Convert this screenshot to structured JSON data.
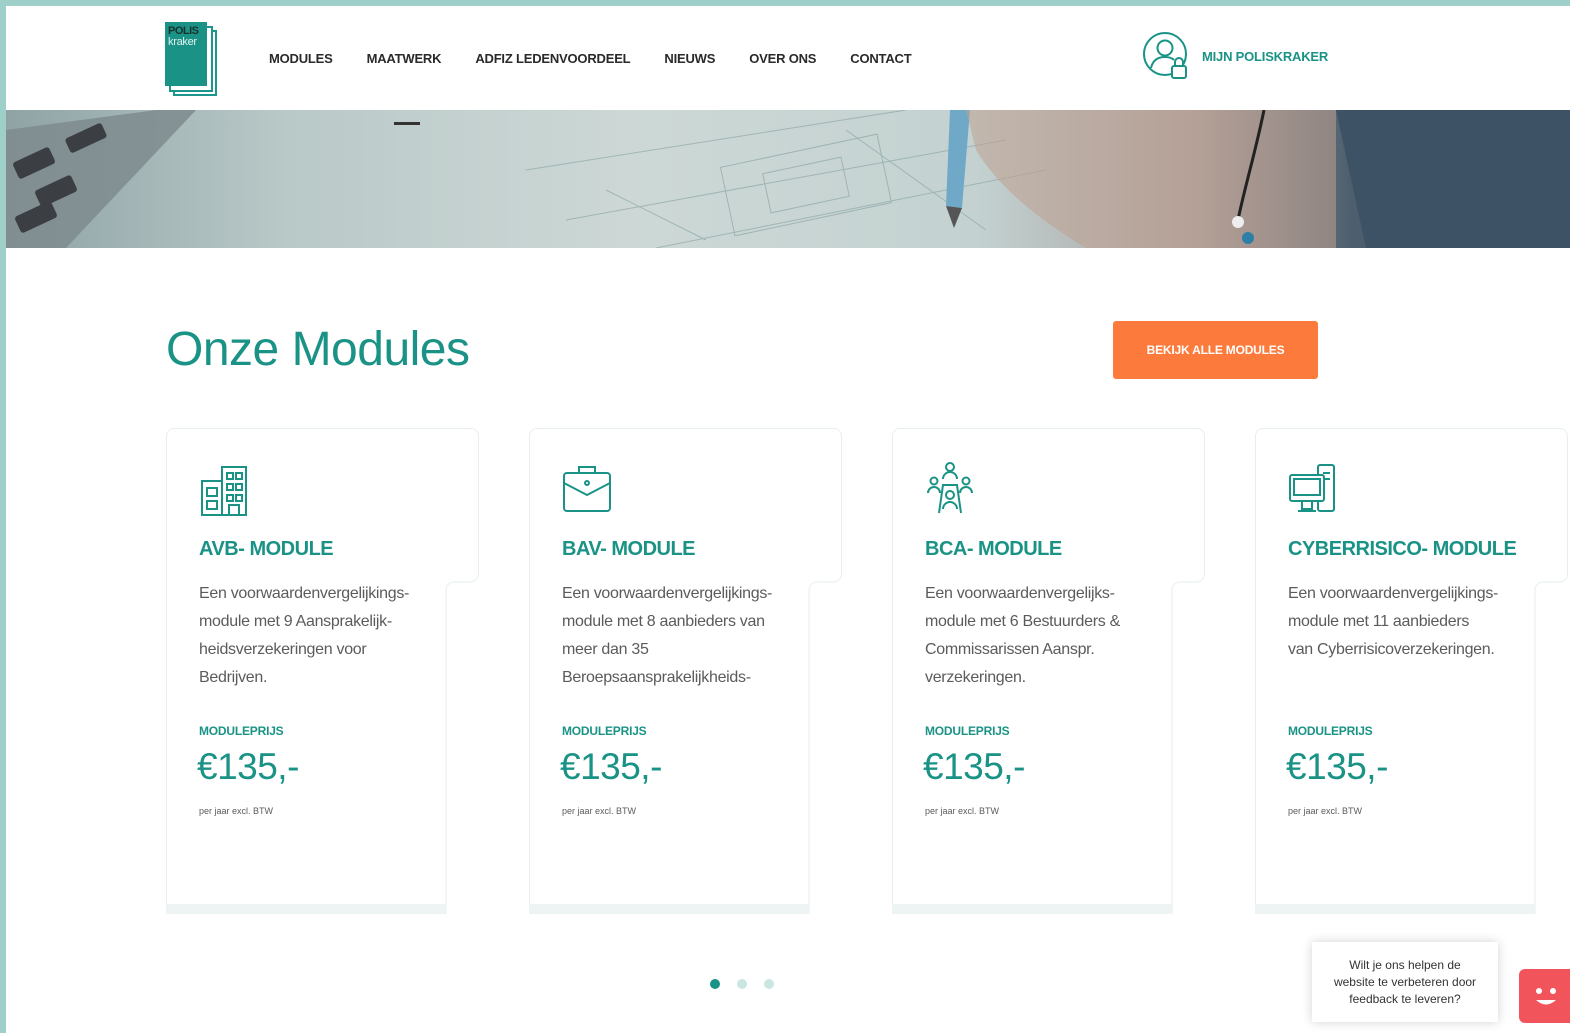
{
  "header": {
    "logo": {
      "line1": "POLIS",
      "line2": "kraker"
    },
    "nav": [
      "MODULES",
      "MAATWERK",
      "ADFIZ LEDENVOORDEEL",
      "NIEUWS",
      "OVER ONS",
      "CONTACT"
    ],
    "account_label": "MIJN POLISKRAKER",
    "account_icon": "user-lock-icon"
  },
  "section": {
    "title": "Onze Modules",
    "cta_label": "BEKIJK ALLE MODULES"
  },
  "cards": [
    {
      "icon": "office-building-icon",
      "title": "AVB- MODULE",
      "desc": [
        "Een voorwaardenvergelijkings-",
        "module met 9 Aansprakelijk-",
        "heidsverzekeringen voor",
        "Bedrijven."
      ],
      "price_label": "MODULEPRIJS",
      "price": "€135,-",
      "price_note": "per jaar excl. BTW"
    },
    {
      "icon": "briefcase-icon",
      "title": "BAV- MODULE",
      "desc": [
        "Een voorwaardenvergelijkings-",
        "module met 8 aanbieders van",
        "meer dan 35",
        "Beroepsaansprakelijkheids-"
      ],
      "price_label": "MODULEPRIJS",
      "price": "€135,-",
      "price_note": "per jaar excl. BTW"
    },
    {
      "icon": "board-meeting-icon",
      "title": "BCA- MODULE",
      "desc": [
        "Een voorwaardenvergelijks-",
        "module met 6 Bestuurders &",
        "Commissarissen Aanspr.",
        "verzekeringen."
      ],
      "price_label": "MODULEPRIJS",
      "price": "€135,-",
      "price_note": "per jaar excl. BTW"
    },
    {
      "icon": "computer-icon",
      "title": "CYBERRISICO- MODULE",
      "desc": [
        "Een voorwaardenvergelijkings-",
        "module met 11 aanbieders",
        "van Cyberrisicoverzekeringen."
      ],
      "price_label": "MODULEPRIJS",
      "price": "€135,-",
      "price_note": "per jaar excl. BTW"
    }
  ],
  "pager": {
    "count": 3,
    "active": 1
  },
  "feedback": {
    "text_lines": [
      "Wilt je ons helpen de",
      "website te verbeteren door",
      "feedback te leveren?"
    ]
  },
  "colors": {
    "brand": "#1a9386",
    "accent": "#fb7a3c",
    "feedback": "#f2545b",
    "frame": "#9fcfc9"
  }
}
